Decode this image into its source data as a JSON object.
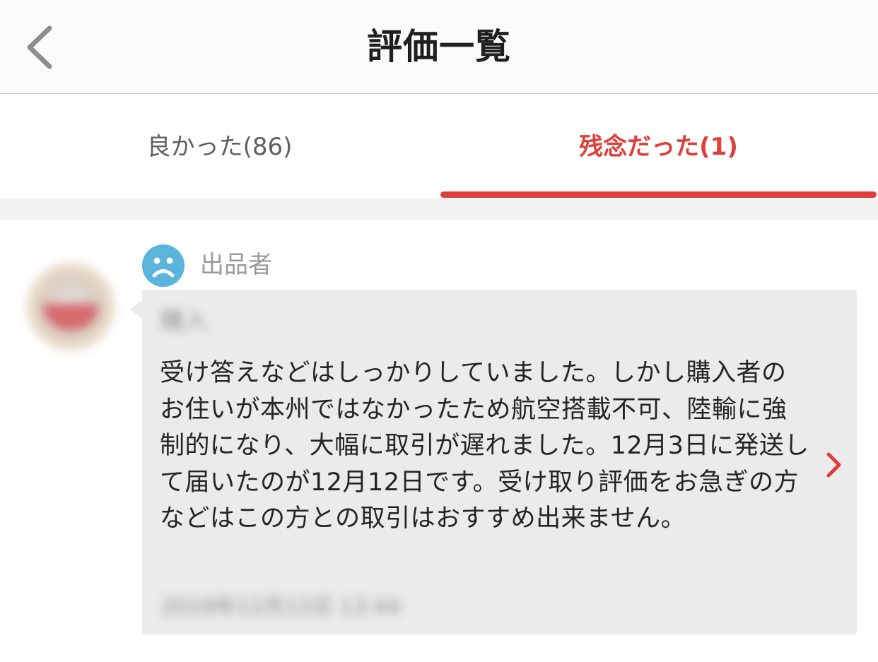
{
  "header": {
    "title": "評価一覧",
    "back_icon": "chevron-left-icon"
  },
  "tabs": [
    {
      "label": "良かった(86)",
      "active": false
    },
    {
      "label": "残念だった(1)",
      "active": true
    }
  ],
  "colors": {
    "accent": "#e03e3a",
    "face_icon": "#5ab4dc",
    "bubble_bg": "#ebebeb"
  },
  "review": {
    "rating_icon": "sad-face-icon",
    "role": "出品者",
    "reviewer_name": "購入",
    "text": "受け答えなどはしっかりしていました。しかし購入者のお住いが本州ではなかったため航空搭載不可、陸輸に強制的になり、大幅に取引が遅れました。12月3日に発送して届いたのが12月12日です。受け取り評価をお急ぎの方などはこの方との取引はおすすめ出来ません。",
    "date": "2019年12月12日 13:44"
  }
}
